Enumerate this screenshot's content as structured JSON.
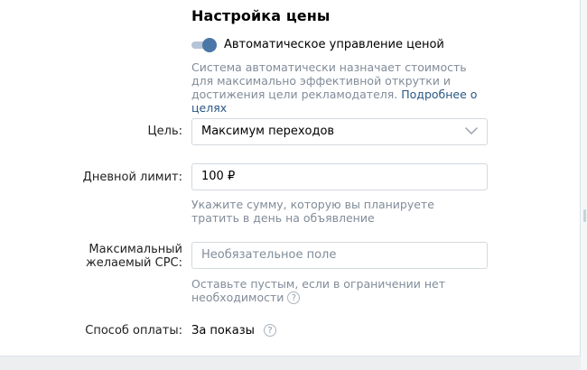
{
  "section": {
    "title": "Настройка цены"
  },
  "auto_price": {
    "enabled": true,
    "label": "Автоматическое управление ценой",
    "hint_text": "Система автоматически назначает стоимость для максимально эффективной открутки и достижения цели рекламодателя.",
    "hint_link": "Подробнее о целях"
  },
  "goal": {
    "label": "Цель:",
    "value": "Максимум переходов",
    "chevron_icon": "chevron-down-icon"
  },
  "daily_limit": {
    "label": "Дневной лимит:",
    "value": "100 ₽",
    "hint": "Укажите сумму, которую вы планируете тратить в день на объявление"
  },
  "max_cpc": {
    "label_line1": "Максимальный",
    "label_line2": "желаемый CPC:",
    "placeholder": "Необязательное поле",
    "hint": "Оставьте пустым, если в ограничении нет необходимости",
    "help_icon": "help-icon"
  },
  "payment": {
    "label": "Способ оплаты:",
    "value": "За показы",
    "help_icon": "help-icon"
  },
  "colors": {
    "accent": "#4a76a8",
    "link": "#2a5885",
    "hint": "#818c99",
    "border": "#d3d9de"
  }
}
